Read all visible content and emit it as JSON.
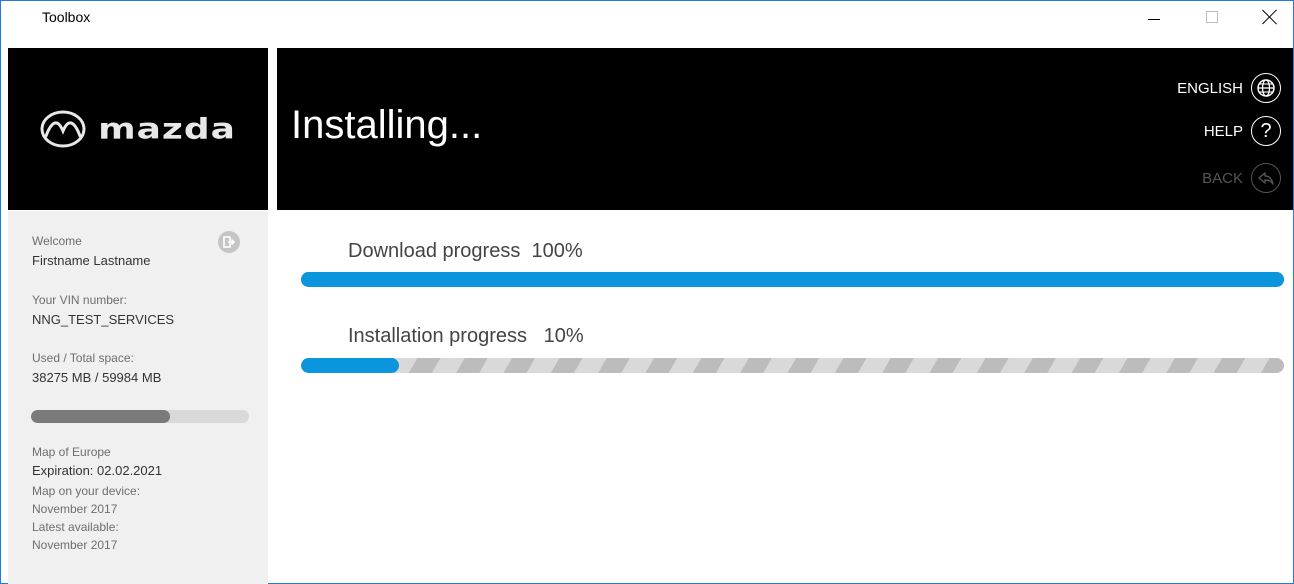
{
  "window": {
    "title": "Toolbox"
  },
  "brand": {
    "logo_text": "mazda"
  },
  "header": {
    "title": "Installing...",
    "language_label": "ENGLISH",
    "help_label": "HELP",
    "back_label": "BACK",
    "help_glyph": "?"
  },
  "sidebar": {
    "welcome_label": "Welcome",
    "user_name": "Firstname Lastname",
    "vin_label": "Your VIN number:",
    "vin_value": "NNG_TEST_SERVICES",
    "space_label": "Used / Total space:",
    "space_value": "38275 MB / 59984 MB",
    "storage_used_fraction": 0.638,
    "map_name": "Map of Europe",
    "expiration": "Expiration: 02.02.2021",
    "map_on_device_label": "Map on your device:",
    "map_on_device_value": "November 2017",
    "latest_label": "Latest available:",
    "latest_value": "November 2017"
  },
  "progress": {
    "download_label": "Download progress",
    "download_percent_text": "100%",
    "download_fraction": 1.0,
    "install_label": "Installation progress",
    "install_percent_text": "10%",
    "install_fraction": 0.1
  },
  "colors": {
    "accent": "#0a95dd",
    "header_bg": "#000000",
    "sidebar_bg": "#f0f0f0"
  },
  "icons": {
    "language": "globe-icon",
    "help": "question-icon",
    "back": "back-arrow-icon",
    "logout": "logout-icon"
  }
}
